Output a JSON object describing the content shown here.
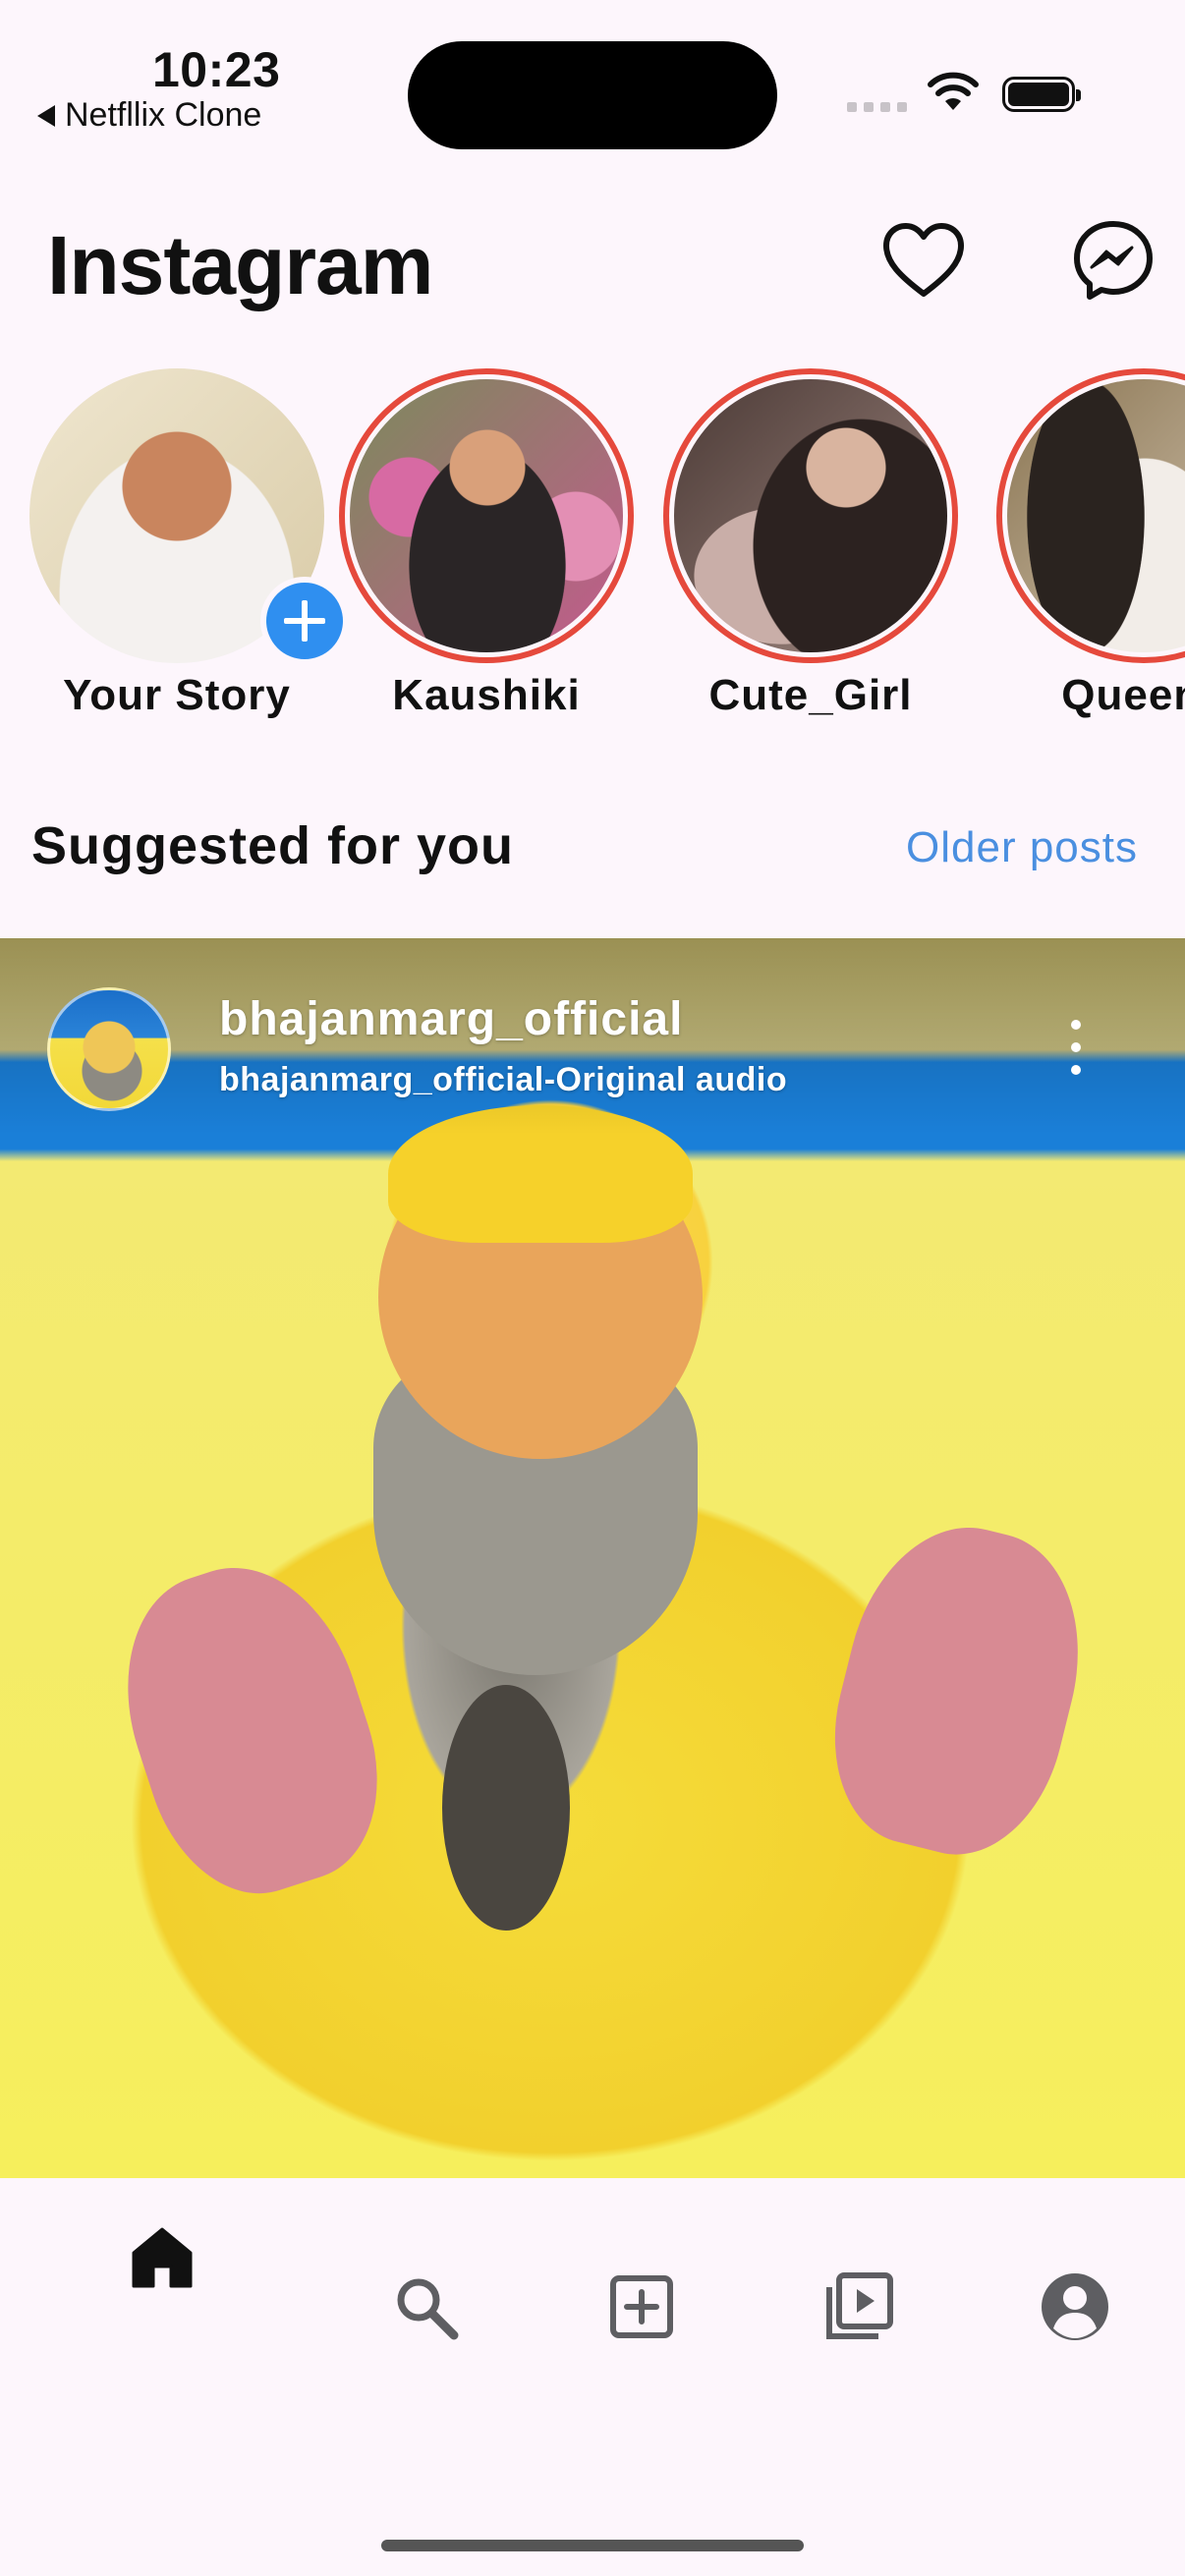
{
  "status_bar": {
    "time": "10:23",
    "back_app": "Netfllix Clone"
  },
  "header": {
    "title": "Instagram",
    "icons": [
      "heart-icon",
      "messenger-icon"
    ]
  },
  "stories": [
    {
      "label": "Your Story",
      "own": true,
      "colors": [
        "#e9e2d6",
        "#f3f1ee"
      ]
    },
    {
      "label": "Kaushiki",
      "own": false,
      "colors": [
        "#d45d96",
        "#3a2e2a"
      ]
    },
    {
      "label": "Cute_Girl",
      "own": false,
      "colors": [
        "#5b4844",
        "#d9c8c3"
      ]
    },
    {
      "label": "Queen_",
      "own": false,
      "colors": [
        "#8b7a60",
        "#efe8e1"
      ]
    }
  ],
  "suggested": {
    "title": "Suggested for you",
    "older_link": "Older posts"
  },
  "post": {
    "username": "bhajanmarg_official",
    "audio": "bhajanmarg_official-Original audio"
  },
  "bottom_nav": {
    "items": [
      "home-icon",
      "search-icon",
      "create-icon",
      "reels-icon",
      "profile-icon"
    ],
    "active": "home-icon"
  },
  "colors": {
    "background": "#fdf6fc",
    "story_ring": "#e5493c",
    "link": "#4a8fe0",
    "add_button": "#2f8ff0"
  }
}
